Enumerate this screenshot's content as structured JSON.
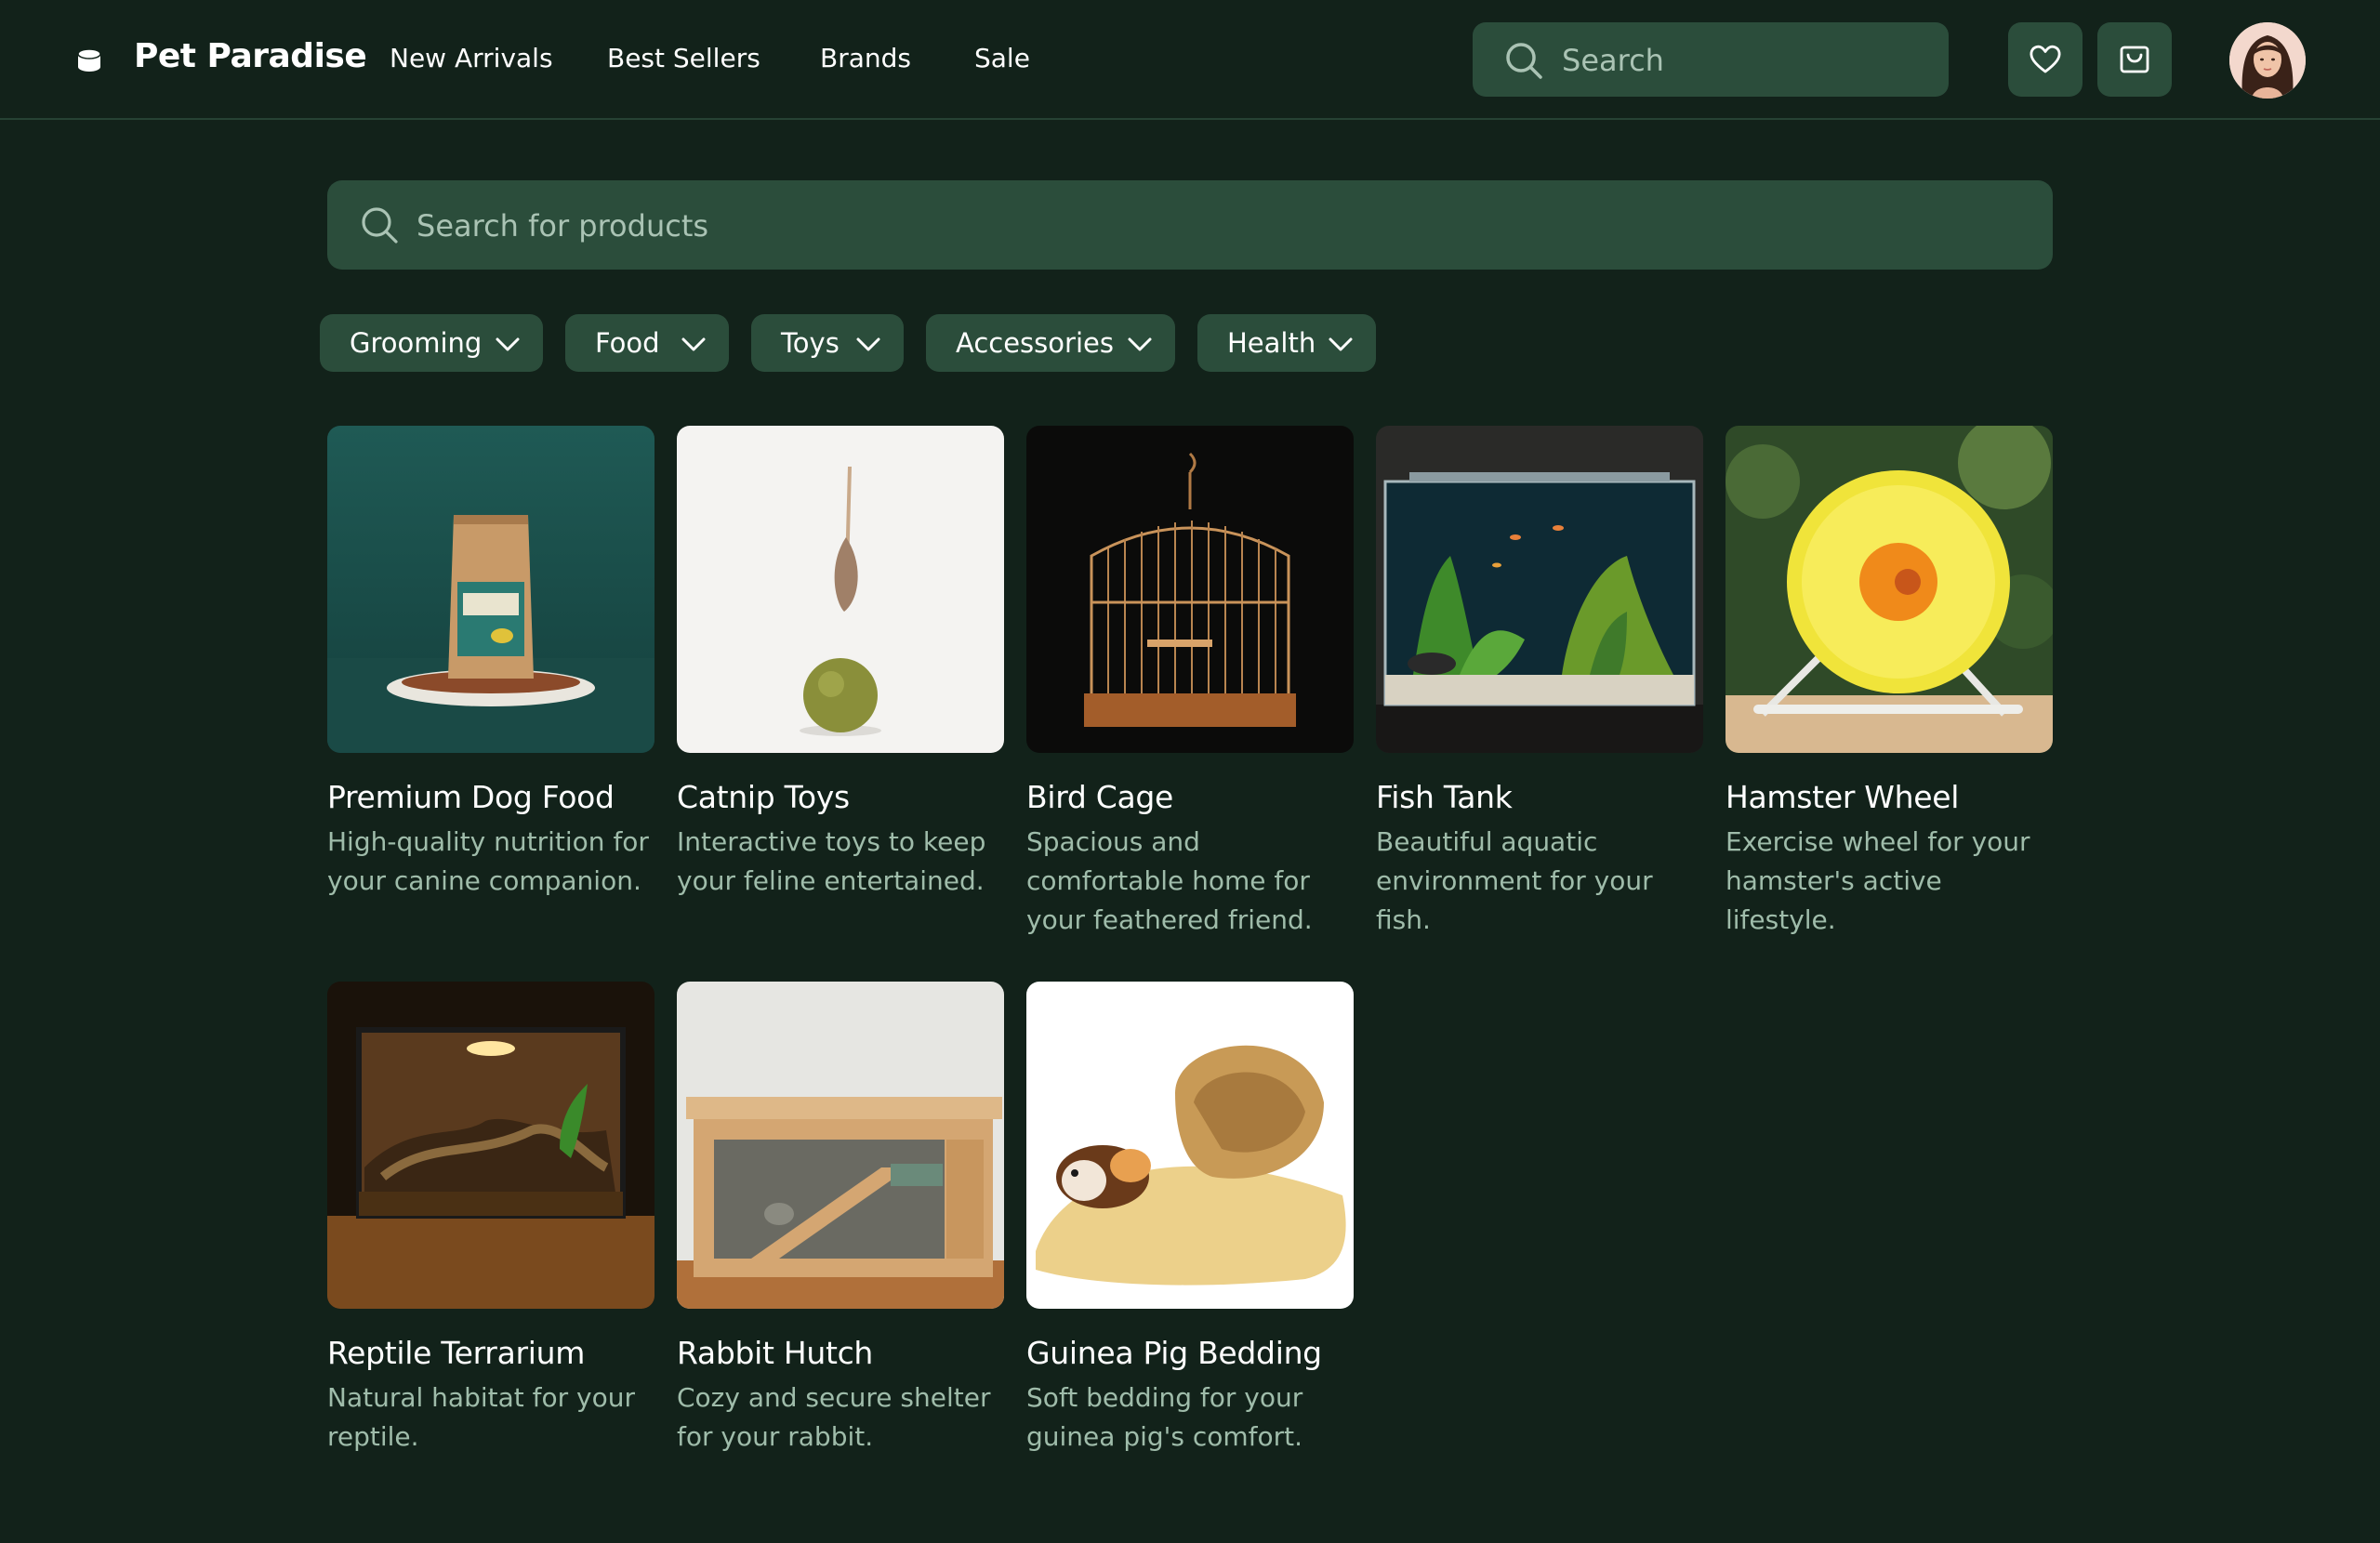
{
  "brand": {
    "name": "Pet Paradise"
  },
  "nav": [
    {
      "label": "New Arrivals"
    },
    {
      "label": "Best Sellers"
    },
    {
      "label": "Brands"
    },
    {
      "label": "Sale"
    }
  ],
  "header_search": {
    "placeholder": "Search",
    "value": ""
  },
  "header_actions": {
    "wishlist_icon": "heart-icon",
    "cart_icon": "shopping-bag-icon"
  },
  "main_search": {
    "placeholder": "Search for products",
    "value": ""
  },
  "filters": [
    {
      "label": "Grooming"
    },
    {
      "label": "Food"
    },
    {
      "label": "Toys"
    },
    {
      "label": "Accessories"
    },
    {
      "label": "Health"
    }
  ],
  "products": [
    {
      "title": "Premium Dog Food",
      "desc": "High-quality nutrition for your canine companion."
    },
    {
      "title": "Catnip Toys",
      "desc": "Interactive toys to keep your feline entertained."
    },
    {
      "title": "Bird Cage",
      "desc": "Spacious and comfortable home for your feathered friend."
    },
    {
      "title": "Fish Tank",
      "desc": "Beautiful aquatic environment for your fish."
    },
    {
      "title": "Hamster Wheel",
      "desc": "Exercise wheel for your hamster's active lifestyle."
    },
    {
      "title": "Reptile Terrarium",
      "desc": "Natural habitat for your reptile."
    },
    {
      "title": "Rabbit Hutch",
      "desc": "Cozy and secure shelter for your rabbit."
    },
    {
      "title": "Guinea Pig Bedding",
      "desc": "Soft bedding for your guinea pig's comfort."
    }
  ],
  "colors": {
    "background": "#12221a",
    "surface": "#2b4d3b",
    "text_primary": "#ffffff",
    "text_secondary": "#9fbcaa",
    "divider": "#264234"
  }
}
